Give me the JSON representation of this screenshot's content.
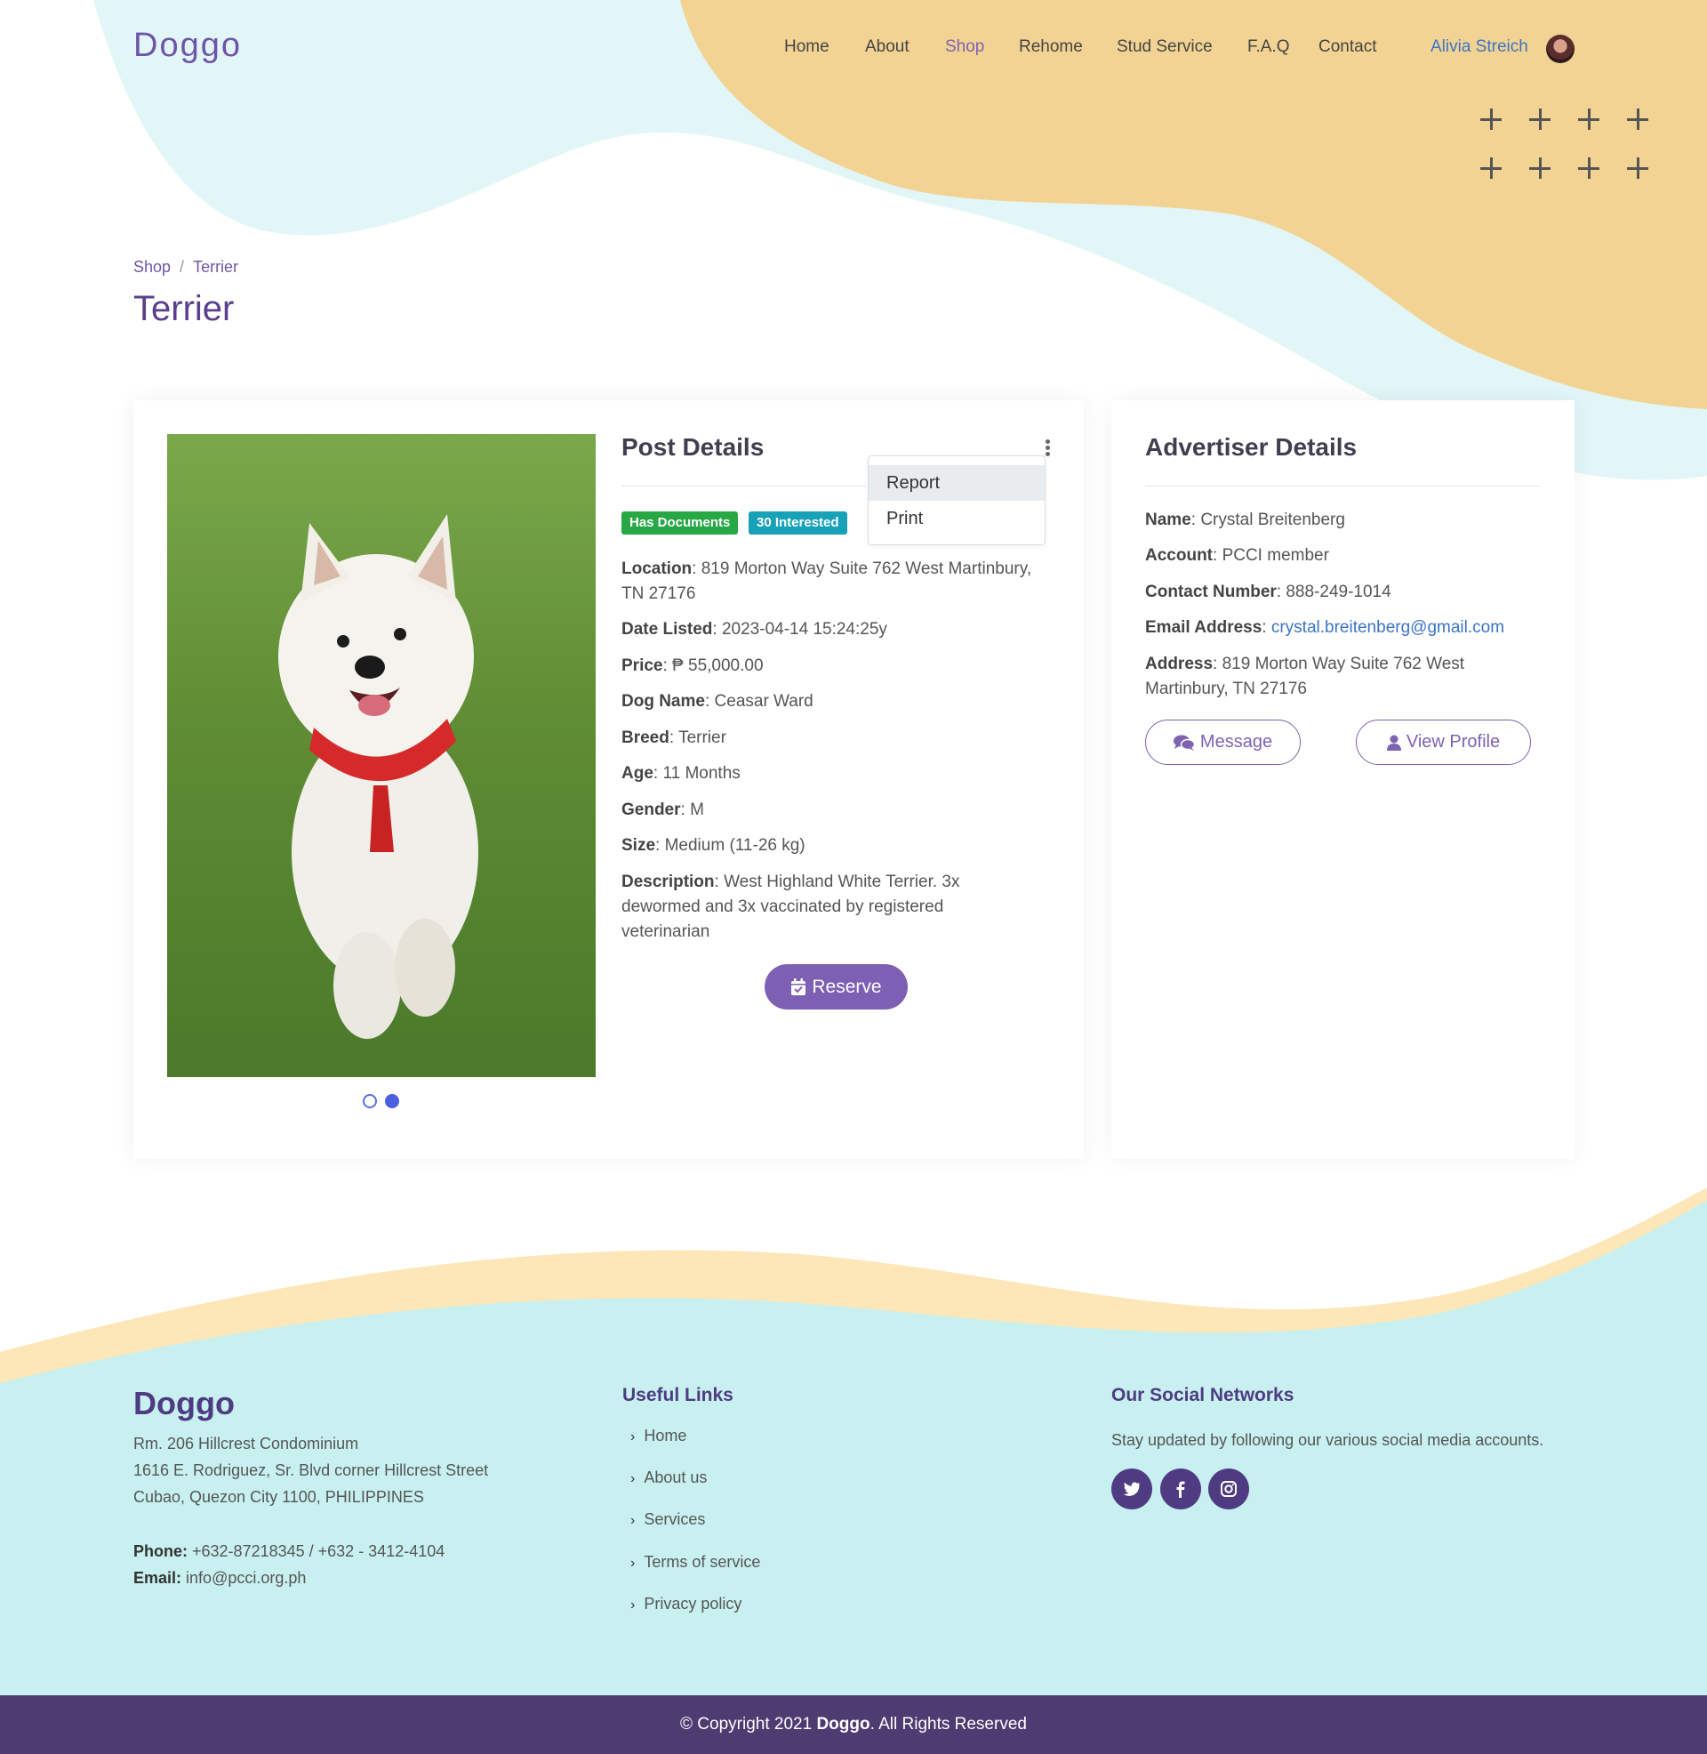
{
  "brand": {
    "logo": "Doggo",
    "footer_logo": "Doggo"
  },
  "nav": {
    "items": [
      "Home",
      "About",
      "Shop",
      "Rehome",
      "Stud Service",
      "F.A.Q",
      "Contact"
    ],
    "active": "Shop",
    "user_name": "Alivia Streich"
  },
  "breadcrumb": {
    "parent": "Shop",
    "separator": "/",
    "current": "Terrier"
  },
  "page_title": "Terrier",
  "post": {
    "title": "Post Details",
    "menu": {
      "items": [
        "Report",
        "Print"
      ],
      "highlighted": "Report"
    },
    "badges": [
      {
        "label": "Has Documents",
        "color": "#28a745"
      },
      {
        "label": "30 Interested",
        "color": "#17a2b8"
      }
    ],
    "fields": {
      "location_label": "Location",
      "location_line1": "819 Morton Way Suite 762 West Martinbury,",
      "location_line2": "TN 27176",
      "date_label": "Date Listed",
      "date": "2023-04-14 15:24:25y",
      "price_label": "Price",
      "price": "₱ 55,000.00",
      "dogname_label": "Dog Name",
      "dogname": "Ceasar Ward",
      "breed_label": "Breed",
      "breed": "Terrier",
      "age_label": "Age",
      "age": "11 Months",
      "gender_label": "Gender",
      "gender": "M",
      "size_label": "Size",
      "size": "Medium (11-26 kg)",
      "desc_label": "Description",
      "desc_line1": "West Highland White Terrier. 3x",
      "desc_line2": "dewormed and 3x vaccinated by registered",
      "desc_line3": "veterinarian"
    },
    "reserve_label": "Reserve",
    "carousel": {
      "slides": 2,
      "active": 2
    }
  },
  "advertiser": {
    "title": "Advertiser Details",
    "name_label": "Name",
    "name": "Crystal Breitenberg",
    "account_label": "Account",
    "account": "PCCI member",
    "contact_label": "Contact Number",
    "contact": "888-249-1014",
    "email_label": "Email Address",
    "email": "crystal.breitenberg@gmail.com",
    "address_label": "Address",
    "address_line1": "819 Morton Way Suite 762 West",
    "address_line2": "Martinbury, TN 27176",
    "message_label": "Message",
    "profile_label": "View Profile"
  },
  "footer": {
    "address_lines": [
      "Rm. 206 Hillcrest Condominium",
      "1616 E. Rodriguez, Sr. Blvd corner Hillcrest Street",
      "Cubao, Quezon City 1100, PHILIPPINES"
    ],
    "phone_label": "Phone:",
    "phone": "+632-87218345 / +632 - 3412-4104",
    "email_label": "Email:",
    "email": "info@pcci.org.ph",
    "links_title": "Useful Links",
    "links": [
      "Home",
      "About us",
      "Services",
      "Terms of service",
      "Privacy policy"
    ],
    "social_title": "Our Social Networks",
    "social_text": "Stay updated by following our various social media accounts.",
    "social_icons": [
      "twitter-icon",
      "facebook-icon",
      "instagram-icon"
    ],
    "copyright_prefix": "© Copyright 2021 ",
    "copyright_brand": "Doggo",
    "copyright_suffix": ". All Rights Reserved"
  },
  "colors": {
    "primary": "#7d5fb3",
    "accent_blue": "#3b74c4",
    "footer_bg": "#c8f0f0",
    "bar": "#4e3b72",
    "peach": "#f3d393",
    "mint": "#e2f6f7"
  }
}
